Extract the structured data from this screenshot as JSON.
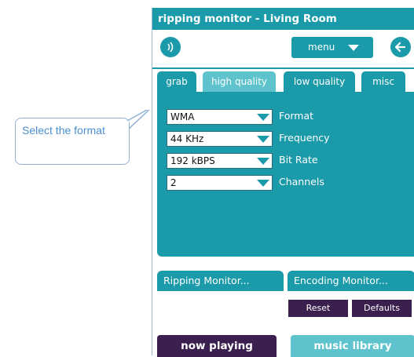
{
  "callout": {
    "text": "Select the format"
  },
  "window": {
    "title": "ripping monitor - Living Room",
    "menu_label": "menu",
    "sound_icon": "speaker-icon",
    "back_icon": "back-arrow-icon"
  },
  "tabs": [
    {
      "label": "grab",
      "active": false
    },
    {
      "label": "high quality",
      "active": true
    },
    {
      "label": "low quality",
      "active": false
    },
    {
      "label": "misc",
      "active": false
    }
  ],
  "settings": [
    {
      "value": "WMA",
      "label": "Format"
    },
    {
      "value": "44 KHz",
      "label": "Frequency"
    },
    {
      "value": "192 kBPS",
      "label": "Bit Rate"
    },
    {
      "value": "2",
      "label": "Channels"
    }
  ],
  "monitors": {
    "ripping": "Ripping Monitor...",
    "encoding": "Encoding Monitor...",
    "reset": "Reset",
    "defaults": "Defaults"
  },
  "bottom": {
    "now_playing": "now playing",
    "music_library": "music library"
  },
  "colors": {
    "teal": "#1b9aaa",
    "teal_light": "#5ec3cc",
    "purple": "#3a1f4f",
    "callout_text": "#4a90d0"
  }
}
